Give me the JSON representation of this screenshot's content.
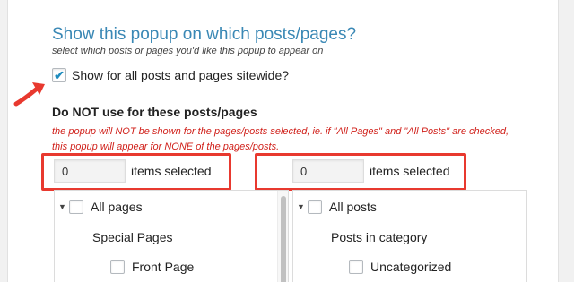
{
  "section": {
    "heading": "Show this popup on which posts/pages?",
    "subheading": "select which posts or pages you'd like this popup to appear on"
  },
  "sitewide": {
    "label": "Show for all posts and pages sitewide?",
    "checked": true,
    "checkmark": "✔"
  },
  "exclude": {
    "heading": "Do NOT use for these posts/pages",
    "warning": "the popup will NOT be shown for the pages/posts selected, ie. if \"All Pages\" and \"All Posts\" are checked, this popup will appear for NONE of the pages/posts."
  },
  "pages_counter": {
    "value": "0",
    "label": "items selected"
  },
  "posts_counter": {
    "value": "0",
    "label": "items selected"
  },
  "pages_tree": {
    "toggle": "▼",
    "root": "All pages",
    "group": "Special Pages",
    "child": "Front Page"
  },
  "posts_tree": {
    "toggle": "▼",
    "root": "All posts",
    "group": "Posts in category",
    "child": "Uncategorized"
  },
  "colors": {
    "heading": "#3a88b5",
    "warning": "#d0201a",
    "highlight": "#e8392f"
  },
  "icons": {
    "annotation_arrow": "red-arrow-icon",
    "tree_toggle": "triangle-down-icon",
    "checkmark": "checkmark-icon"
  }
}
